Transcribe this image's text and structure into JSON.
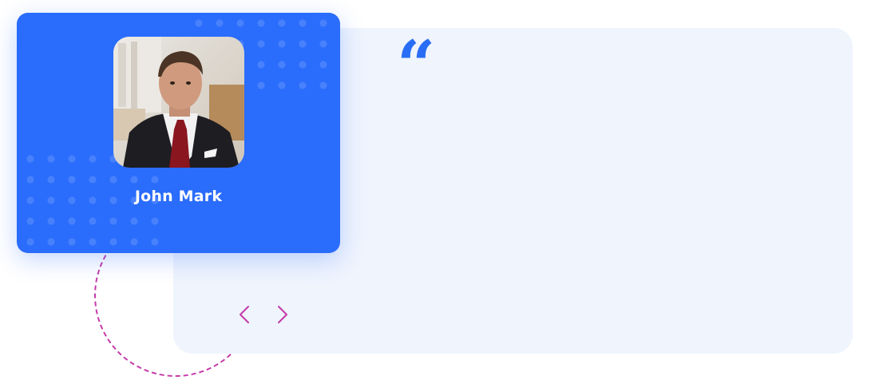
{
  "testimonial": {
    "author_name": "John Mark",
    "quote_icon": "quote-icon",
    "quote_mark": "“",
    "avatar_icon": "avatar-photo",
    "prev_icon": "chevron-left-icon",
    "next_icon": "chevron-right-icon"
  },
  "colors": {
    "card_blue": "#2a6cfb",
    "panel_bg": "#eff4fd",
    "accent_magenta": "#c43aa8",
    "quote_blue": "#2a6df5"
  }
}
